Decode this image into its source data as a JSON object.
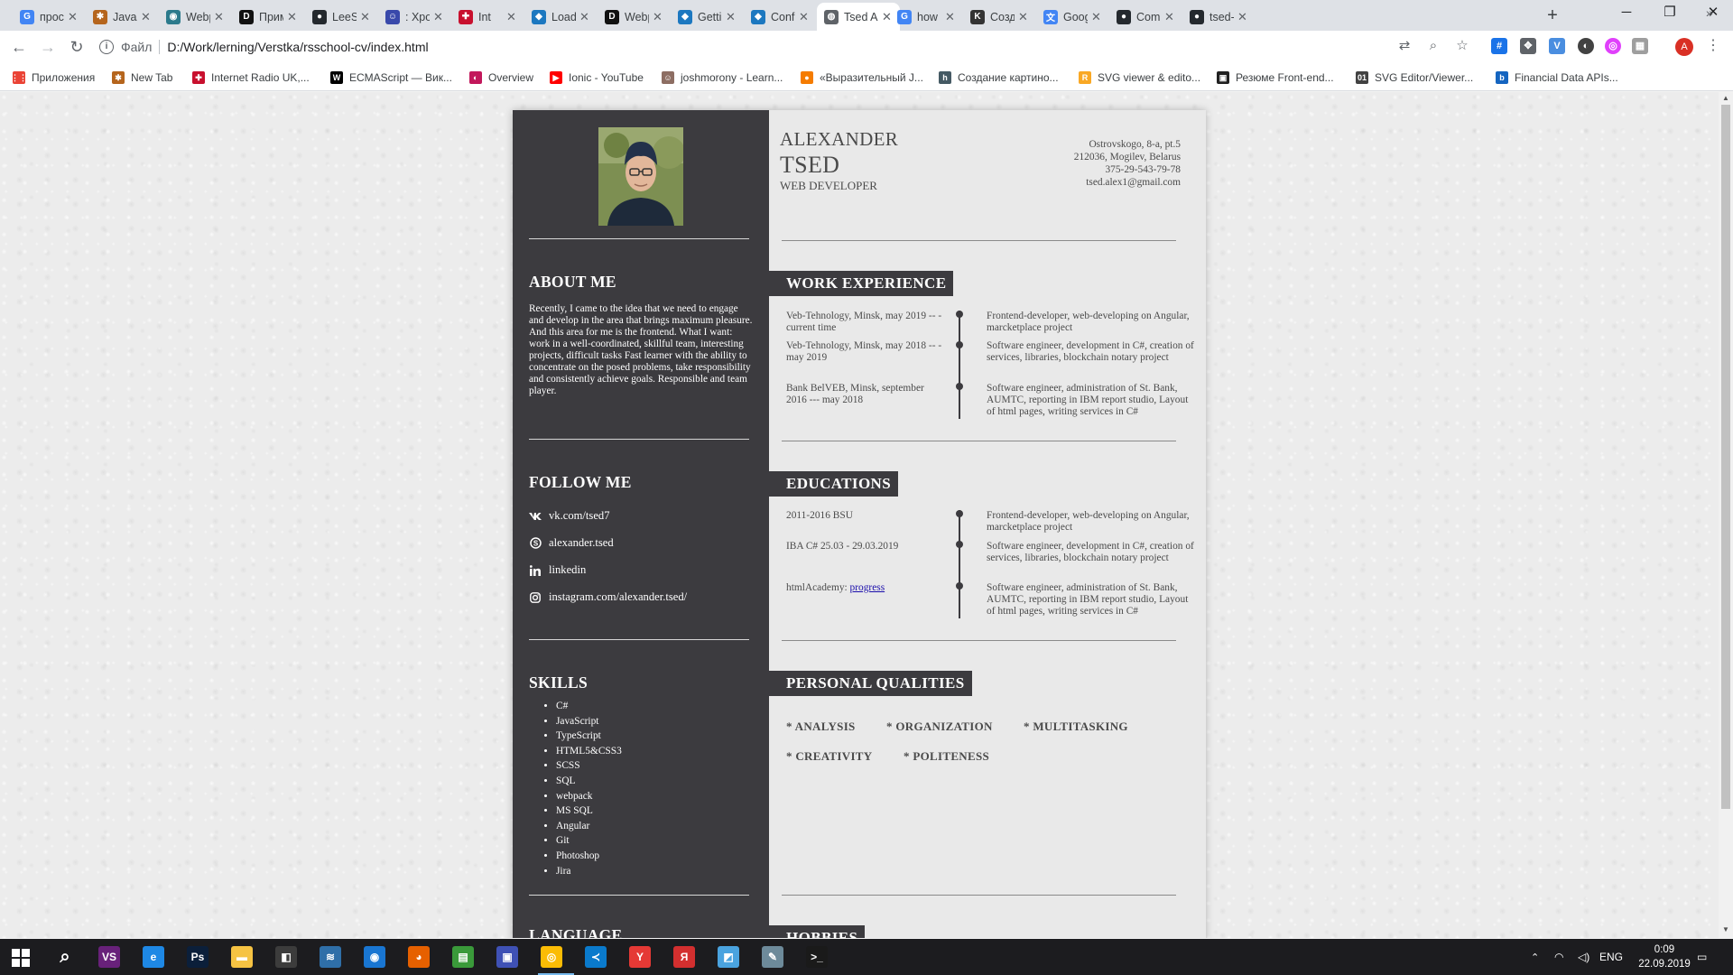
{
  "browser": {
    "tabs": [
      {
        "label": "просто",
        "icon": "google-icon",
        "color": "#4285f4",
        "glyph": "G"
      },
      {
        "label": "Javascr",
        "icon": "puzzle-icon",
        "color": "#b5651d",
        "glyph": "✱"
      },
      {
        "label": "Webpa",
        "icon": "webpack-icon",
        "color": "#2b7a8c",
        "glyph": "◉"
      },
      {
        "label": "Приме",
        "icon": "devto-icon",
        "color": "#111111",
        "glyph": "D"
      },
      {
        "label": "LeeSwi",
        "icon": "github-icon",
        "color": "#24292e",
        "glyph": "●"
      },
      {
        "label": ": Хрон",
        "icon": "person-icon",
        "color": "#3949ab",
        "glyph": "☺"
      },
      {
        "label": "Int",
        "icon": "flag-uk-icon",
        "color": "#c8102e",
        "glyph": "✚"
      },
      {
        "label": "Loade",
        "icon": "webpack-blue-icon",
        "color": "#1c78c0",
        "glyph": "◆"
      },
      {
        "label": "Webpa",
        "icon": "devto-icon",
        "color": "#111111",
        "glyph": "D"
      },
      {
        "label": "Gettin",
        "icon": "webpack-blue-icon",
        "color": "#1c78c0",
        "glyph": "◆"
      },
      {
        "label": "Config",
        "icon": "webpack-blue-icon",
        "color": "#1c78c0",
        "glyph": "◆"
      },
      {
        "label": "Tsed A",
        "icon": "globe-icon",
        "color": "#5f6368",
        "glyph": "◍"
      },
      {
        "label": "how in",
        "icon": "google-icon",
        "color": "#4285f4",
        "glyph": "G"
      },
      {
        "label": "Созда",
        "icon": "k-icon",
        "color": "#333333",
        "glyph": "K"
      },
      {
        "label": "Googl",
        "icon": "translate-icon",
        "color": "#4285f4",
        "glyph": "文"
      },
      {
        "label": "Comp",
        "icon": "github-icon",
        "color": "#24292e",
        "glyph": "●"
      },
      {
        "label": "tsed-a",
        "icon": "github-icon",
        "color": "#24292e",
        "glyph": "●"
      }
    ],
    "active_tab": 11,
    "address": {
      "scheme": "Файл",
      "url": "D:/Work/lerning/Verstka/rsschool-cv/index.html"
    },
    "avatar_letter": "A",
    "bookmarks": [
      {
        "label": "Приложения",
        "icon": "apps-grid-icon",
        "color": "#ea4335",
        "glyph": "⋮⋮"
      },
      {
        "label": "New Tab",
        "icon": "puzzle-icon",
        "color": "#b5651d",
        "glyph": "✱"
      },
      {
        "label": "Internet Radio UK,...",
        "icon": "flag-uk-icon",
        "color": "#c8102e",
        "glyph": "✚"
      },
      {
        "label": "ECMAScript — Вик...",
        "icon": "wikipedia-icon",
        "color": "#000000",
        "glyph": "W"
      },
      {
        "label": "Overview",
        "icon": "ionic-icon",
        "color": "#c2185b",
        "glyph": "◐"
      },
      {
        "label": "Ionic - YouTube",
        "icon": "youtube-icon",
        "color": "#ff0000",
        "glyph": "▶"
      },
      {
        "label": "joshmorony - Learn...",
        "icon": "person-icon",
        "color": "#8d6e63",
        "glyph": "☺"
      },
      {
        "label": "«Выразительный J...",
        "icon": "orange-circle-icon",
        "color": "#f57c00",
        "glyph": "●"
      },
      {
        "label": "Создание картино...",
        "icon": "h-icon",
        "color": "#455a64",
        "glyph": "h"
      },
      {
        "label": "SVG viewer & edito...",
        "icon": "r-icon",
        "color": "#f9a825",
        "glyph": "R"
      },
      {
        "label": "Резюме Front-end...",
        "icon": "dark-box-icon",
        "color": "#212121",
        "glyph": "▣"
      },
      {
        "label": "SVG Editor/Viewer...",
        "icon": "o1-icon",
        "color": "#424242",
        "glyph": "01"
      },
      {
        "label": "Financial Data APIs...",
        "icon": "b-icon",
        "color": "#1565c0",
        "glyph": "b"
      }
    ]
  },
  "cv": {
    "name_first": "ALEXANDER",
    "name_last": "TSED",
    "role": "WEB DEVELOPER",
    "contacts": [
      "Ostrovskogo, 8-a, pt.5",
      "212036, Mogilev, Belarus",
      "375-29-543-79-78",
      "tsed.alex1@gmail.com"
    ],
    "about": {
      "title": "ABOUT ME",
      "text": "Recently, I came to the idea that we need to engage and develop in the area that brings maximum pleasure. And this area for me is the frontend. What I want: work in a well-coordinated, skillful team, interesting projects, difficult tasks Fast learner with the ability to concentrate on the posed problems, take responsibility and consistently achieve goals. Responsible and team player."
    },
    "follow": {
      "title": "FOLLOW ME",
      "links": [
        {
          "label": "vk.com/tsed7",
          "icon": "vk-icon"
        },
        {
          "label": "alexander.tsed",
          "icon": "skype-icon"
        },
        {
          "label": "linkedin",
          "icon": "linkedin-icon"
        },
        {
          "label": "instagram.com/alexander.tsed/",
          "icon": "instagram-icon"
        }
      ]
    },
    "skills": {
      "title": "SKILLS",
      "items": [
        "C#",
        "JavaScript",
        "TypeScript",
        "HTML5&CSS3",
        "SCSS",
        "SQL",
        "webpack",
        "MS SQL",
        "Angular",
        "Git",
        "Photoshop",
        "Jira"
      ]
    },
    "language_title": "LANGUAGE",
    "work": {
      "title": "WORK EXPERIENCE",
      "items": [
        {
          "when": "Veb-Tehnology, Minsk, may 2019 -- - current time",
          "what": "Frontend-developer, web-developing on Angular, marcketplace project"
        },
        {
          "when": "Veb-Tehnology, Minsk, may 2018 -- - may 2019",
          "what": "Software engineer, development in C#, creation of services, libraries, blockchain notary project"
        },
        {
          "when": "Bank BelVEB, Minsk, september 2016 --- may 2018",
          "what": "Software engineer, administration of St. Bank, AUMTC, reporting in IBM report studio, Layout of html pages, writing services in C#"
        }
      ]
    },
    "education": {
      "title": "EDUCATIONS",
      "items": [
        {
          "when": "2011-2016 BSU",
          "what": "Frontend-developer, web-developing on Angular, marcketplace project"
        },
        {
          "when": "IBA C# 25.03 - 29.03.2019",
          "what": "Software engineer, development in C#, creation of services, libraries, blockchain notary project"
        },
        {
          "when": "htmlAcademy: ",
          "link": "progress",
          "what": "Software engineer, administration of St. Bank, AUMTC, reporting in IBM report studio, Layout of html pages, writing services in C#"
        }
      ]
    },
    "qualities": {
      "title": "PERSONAL QUALITIES",
      "items": [
        "ANALYSIS",
        "ORGANIZATION",
        "MULTITASKING",
        "CREATIVITY",
        "POLITENESS"
      ]
    },
    "hobbies_title": "HOBBIES"
  },
  "taskbar": {
    "apps": [
      {
        "name": "search-icon",
        "color": "transparent",
        "glyph": "⌕"
      },
      {
        "name": "visual-studio-icon",
        "color": "#68217a",
        "glyph": "VS"
      },
      {
        "name": "edge-icon",
        "color": "#1e88e5",
        "glyph": "e"
      },
      {
        "name": "photoshop-icon",
        "color": "#0b1f3a",
        "glyph": "Ps"
      },
      {
        "name": "explorer-icon",
        "color": "#f6c343",
        "glyph": "▬"
      },
      {
        "name": "store-icon",
        "color": "#3c3c3c",
        "glyph": "◧"
      },
      {
        "name": "app-icon",
        "color": "#2f6fa8",
        "glyph": "≋"
      },
      {
        "name": "maps-icon",
        "color": "#1976d2",
        "glyph": "◉"
      },
      {
        "name": "firefox-icon",
        "color": "#e66000",
        "glyph": "◕"
      },
      {
        "name": "notepad-icon",
        "color": "#3a9a3a",
        "glyph": "▤"
      },
      {
        "name": "save-icon",
        "color": "#3f51b5",
        "glyph": "▣"
      },
      {
        "name": "chrome-icon",
        "color": "#fbbc05",
        "glyph": "◎"
      },
      {
        "name": "vscode-icon",
        "color": "#0a7acc",
        "glyph": "≺"
      },
      {
        "name": "yandex-icon",
        "color": "#e53935",
        "glyph": "Y"
      },
      {
        "name": "yandex-browser-icon",
        "color": "#d32f2f",
        "glyph": "Я"
      },
      {
        "name": "paint-icon",
        "color": "#4aa3df",
        "glyph": "◩"
      },
      {
        "name": "tools-icon",
        "color": "#6d8a9a",
        "glyph": "✎"
      },
      {
        "name": "terminal-icon",
        "color": "#1a1a1a",
        "glyph": ">_"
      }
    ],
    "language": "ENG",
    "time": "0:09",
    "date": "22.09.2019"
  }
}
